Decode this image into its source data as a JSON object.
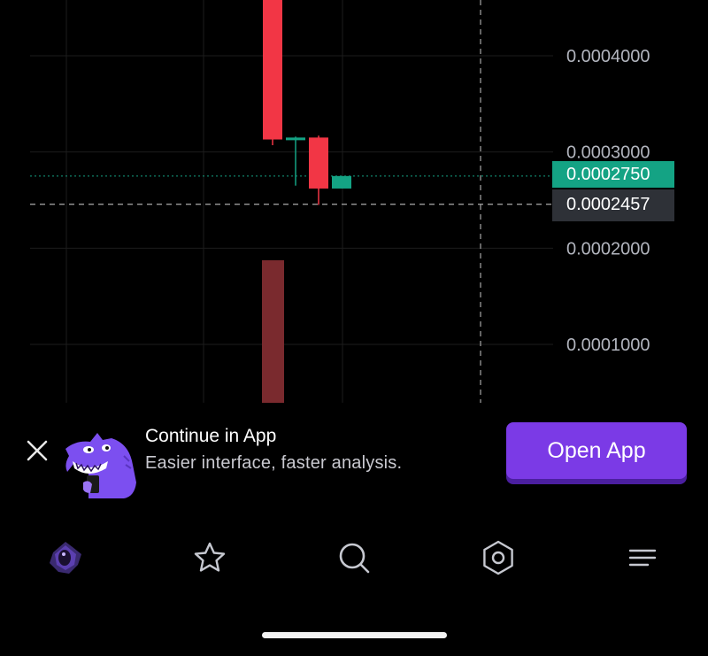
{
  "chart": {
    "y_axis_labels": [
      "0.0004000",
      "0.0003000",
      "0.0002000",
      "0.0001000"
    ],
    "current_price": "0.0002750",
    "crosshair_price": "0.0002457",
    "colors": {
      "up": "#14a384",
      "down": "#f23645",
      "volume_down": "#7a2a2e",
      "grid": "#1c1c1c",
      "axis_text": "#b2b5be"
    }
  },
  "chart_data": {
    "type": "candlestick",
    "y_axis_ticks": [
      0.0001,
      0.0002,
      0.0003,
      0.0004
    ],
    "candles": [
      {
        "open": 0.00046,
        "high": 0.00046,
        "low": 0.000307,
        "close": 0.000313,
        "direction": "down"
      },
      {
        "open": 0.000313,
        "high": 0.000316,
        "low": 0.000265,
        "close": 0.000315,
        "direction": "up"
      },
      {
        "open": 0.000315,
        "high": 0.000317,
        "low": 0.000245,
        "close": 0.000262,
        "direction": "down"
      },
      {
        "open": 0.000262,
        "high": 0.000275,
        "low": 0.000262,
        "close": 0.000275,
        "direction": "up"
      }
    ],
    "current_price": 0.000275,
    "crosshair_price": 0.0002457
  },
  "banner": {
    "title": "Continue in App",
    "subtitle": "Easier interface, faster analysis.",
    "button_label": "Open App",
    "close_icon": "close-icon",
    "mascot": "mascot-icon",
    "button_color": "#7b3ae6"
  },
  "nav": {
    "items": [
      {
        "icon": "home-logo-icon"
      },
      {
        "icon": "star-icon"
      },
      {
        "icon": "search-icon"
      },
      {
        "icon": "settings-hex-icon"
      },
      {
        "icon": "menu-icon"
      }
    ]
  }
}
